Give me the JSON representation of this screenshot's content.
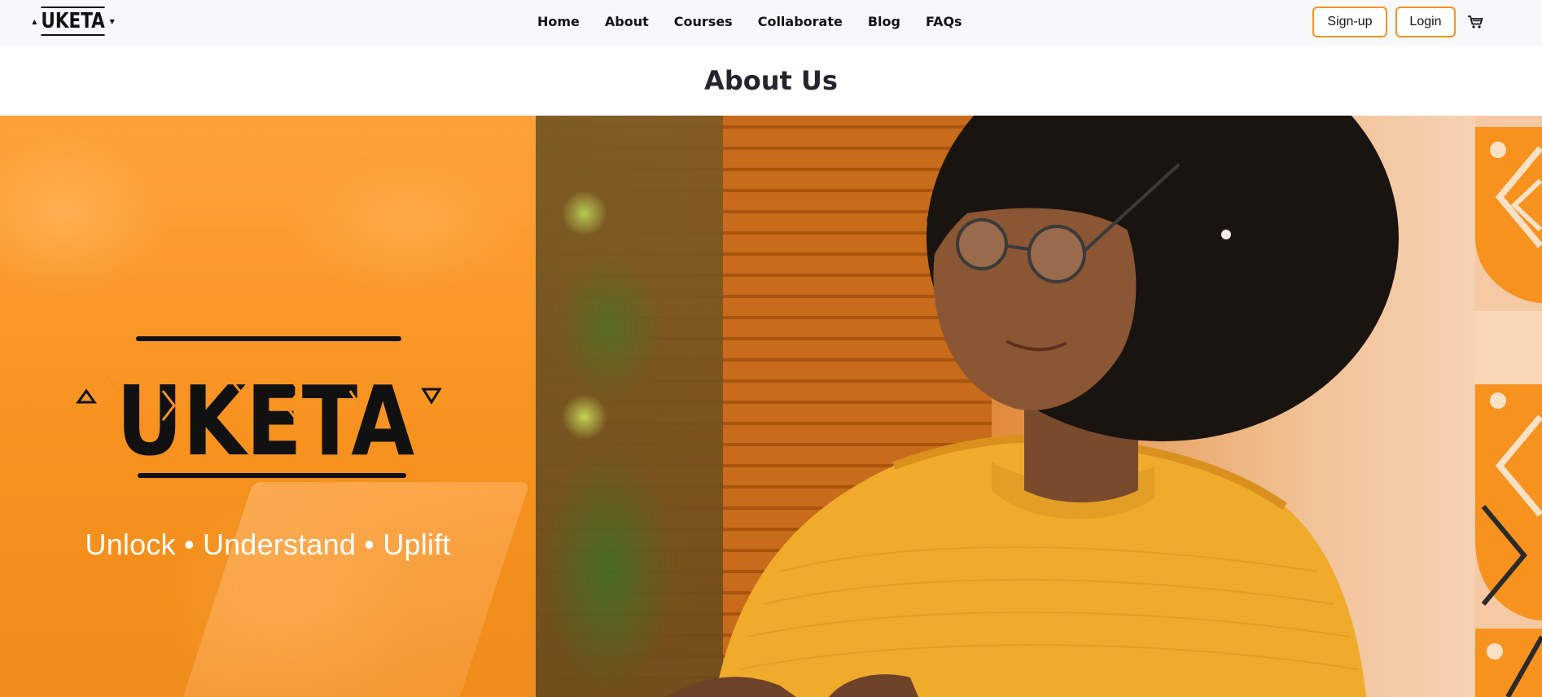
{
  "nav": {
    "brand": "UKETA",
    "links": [
      {
        "label": "Home"
      },
      {
        "label": "About"
      },
      {
        "label": "Courses"
      },
      {
        "label": "Collaborate"
      },
      {
        "label": "Blog"
      },
      {
        "label": "FAQs"
      }
    ],
    "signup_label": "Sign-up",
    "login_label": "Login",
    "cart_icon": "cart-icon"
  },
  "page": {
    "title": "About Us"
  },
  "hero": {
    "logo_text": "UKETA",
    "tagline": "Unlock • Understand • Uplift"
  },
  "colors": {
    "accent": "#f7931e",
    "nav_bg": "#f7f8fa",
    "hero_orange": "#f7921f",
    "text_dark": "#141414"
  }
}
